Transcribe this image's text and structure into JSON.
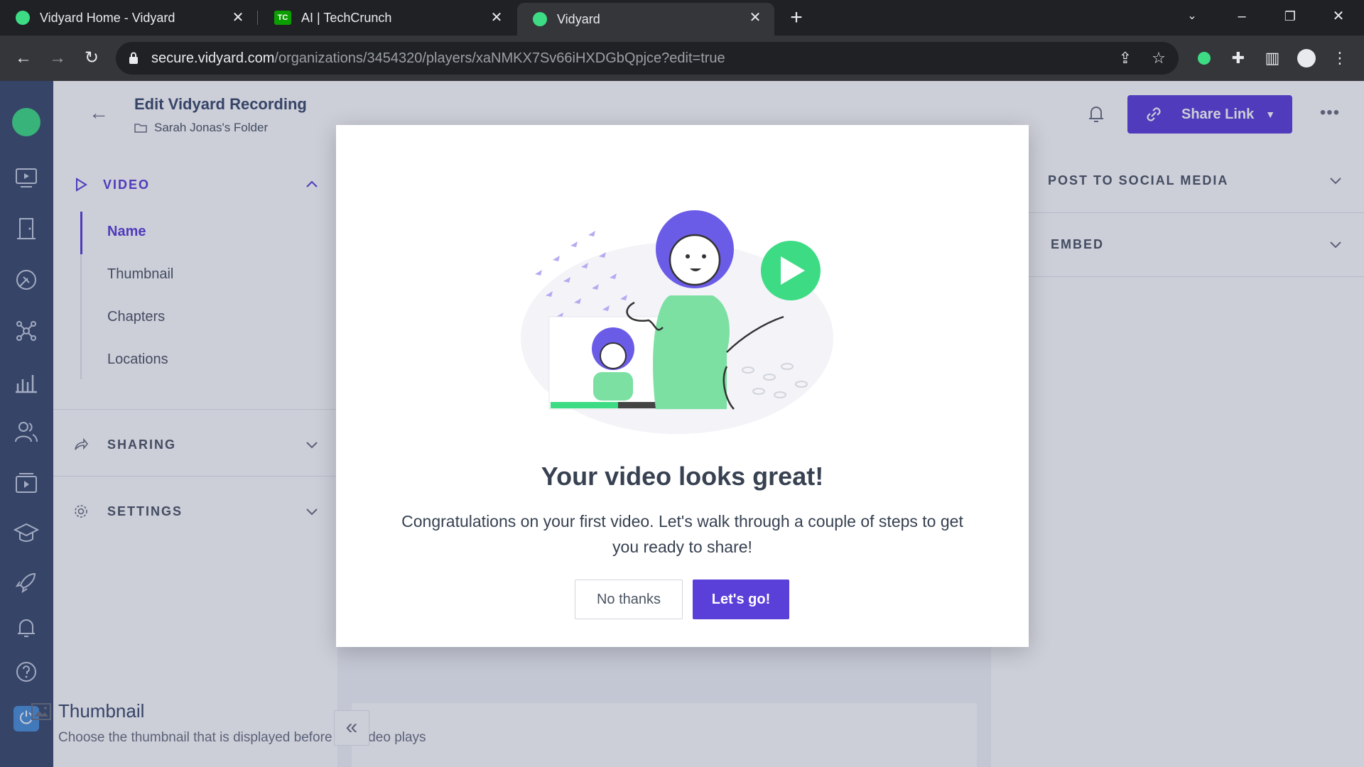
{
  "browser": {
    "tabs": [
      {
        "title": "Vidyard Home - Vidyard",
        "active": false,
        "favicon_color": "#3ddc84"
      },
      {
        "title": "AI | TechCrunch",
        "active": false,
        "favicon_color": "#0a9e01"
      },
      {
        "title": "Vidyard",
        "active": true,
        "favicon_color": "#3ddc84"
      }
    ],
    "url_host": "secure.vidyard.com",
    "url_path": "/organizations/3454320/players/xaNMKX7Sv66iHXDGbQpjce?edit=true"
  },
  "header": {
    "title": "Edit Vidyard Recording",
    "folder": "Sarah Jonas's Folder",
    "share_button": "Share Link"
  },
  "left_panel": {
    "video_section": "VIDEO",
    "video_items": [
      "Name",
      "Thumbnail",
      "Chapters",
      "Locations"
    ],
    "active_item": "Name",
    "sharing_section": "SHARING",
    "settings_section": "SETTINGS"
  },
  "right_panel": {
    "social_section": "POST TO SOCIAL MEDIA",
    "embed_section": "EMBED"
  },
  "center": {
    "thumbnail_title": "Thumbnail",
    "thumbnail_desc": "Choose the thumbnail that is displayed before the video plays"
  },
  "modal": {
    "title": "Your video looks great!",
    "body": "Congratulations on your first video. Let's walk through a couple of steps to get you ready to share!",
    "no_button": "No thanks",
    "go_button": "Let's go!"
  },
  "colors": {
    "accent": "#5b3fd9",
    "rail": "#3b4a6b",
    "brand_green": "#3ddc84",
    "illustration_purple": "#6b5ce7"
  }
}
